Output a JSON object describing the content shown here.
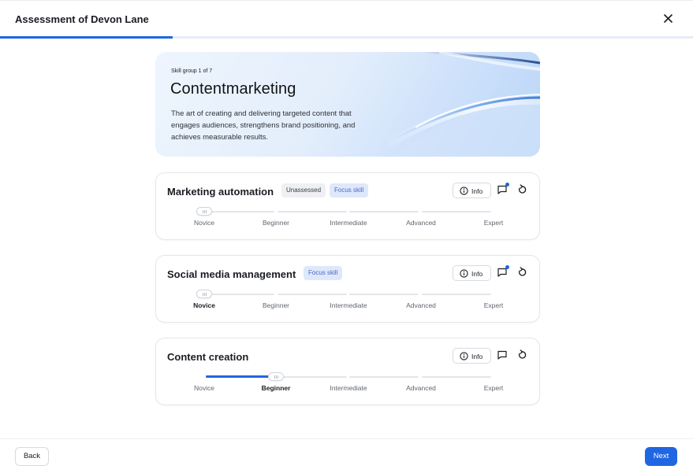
{
  "header": {
    "title": "Assessment of Devon Lane",
    "close_icon": "close-icon"
  },
  "progress": {
    "fraction": 0.25
  },
  "hero": {
    "kicker": "Skill group 1 of 7",
    "title": "Contentmarketing",
    "description": "The art of creating and delivering targeted content that engages audiences, strengthens brand positioning, and achieves measurable results."
  },
  "levels": [
    "Novice",
    "Beginner",
    "Intermediate",
    "Advanced",
    "Expert"
  ],
  "skills": [
    {
      "name": "Marketing automation",
      "chips": [
        "Unassessed",
        "Focus skill"
      ],
      "info_label": "Info",
      "has_comment": true,
      "level_index": 0,
      "assessed": false
    },
    {
      "name": "Social media management",
      "chips": [
        "Focus skill"
      ],
      "info_label": "Info",
      "has_comment": true,
      "level_index": 0,
      "assessed": true
    },
    {
      "name": "Content creation",
      "chips": [],
      "info_label": "Info",
      "has_comment": false,
      "level_index": 1,
      "assessed": true
    }
  ],
  "footer": {
    "back_label": "Back",
    "next_label": "Next"
  },
  "colors": {
    "accent": "#2066e3",
    "chip_focus_bg": "#dfe8fb",
    "chip_focus_text": "#4a67c9"
  }
}
